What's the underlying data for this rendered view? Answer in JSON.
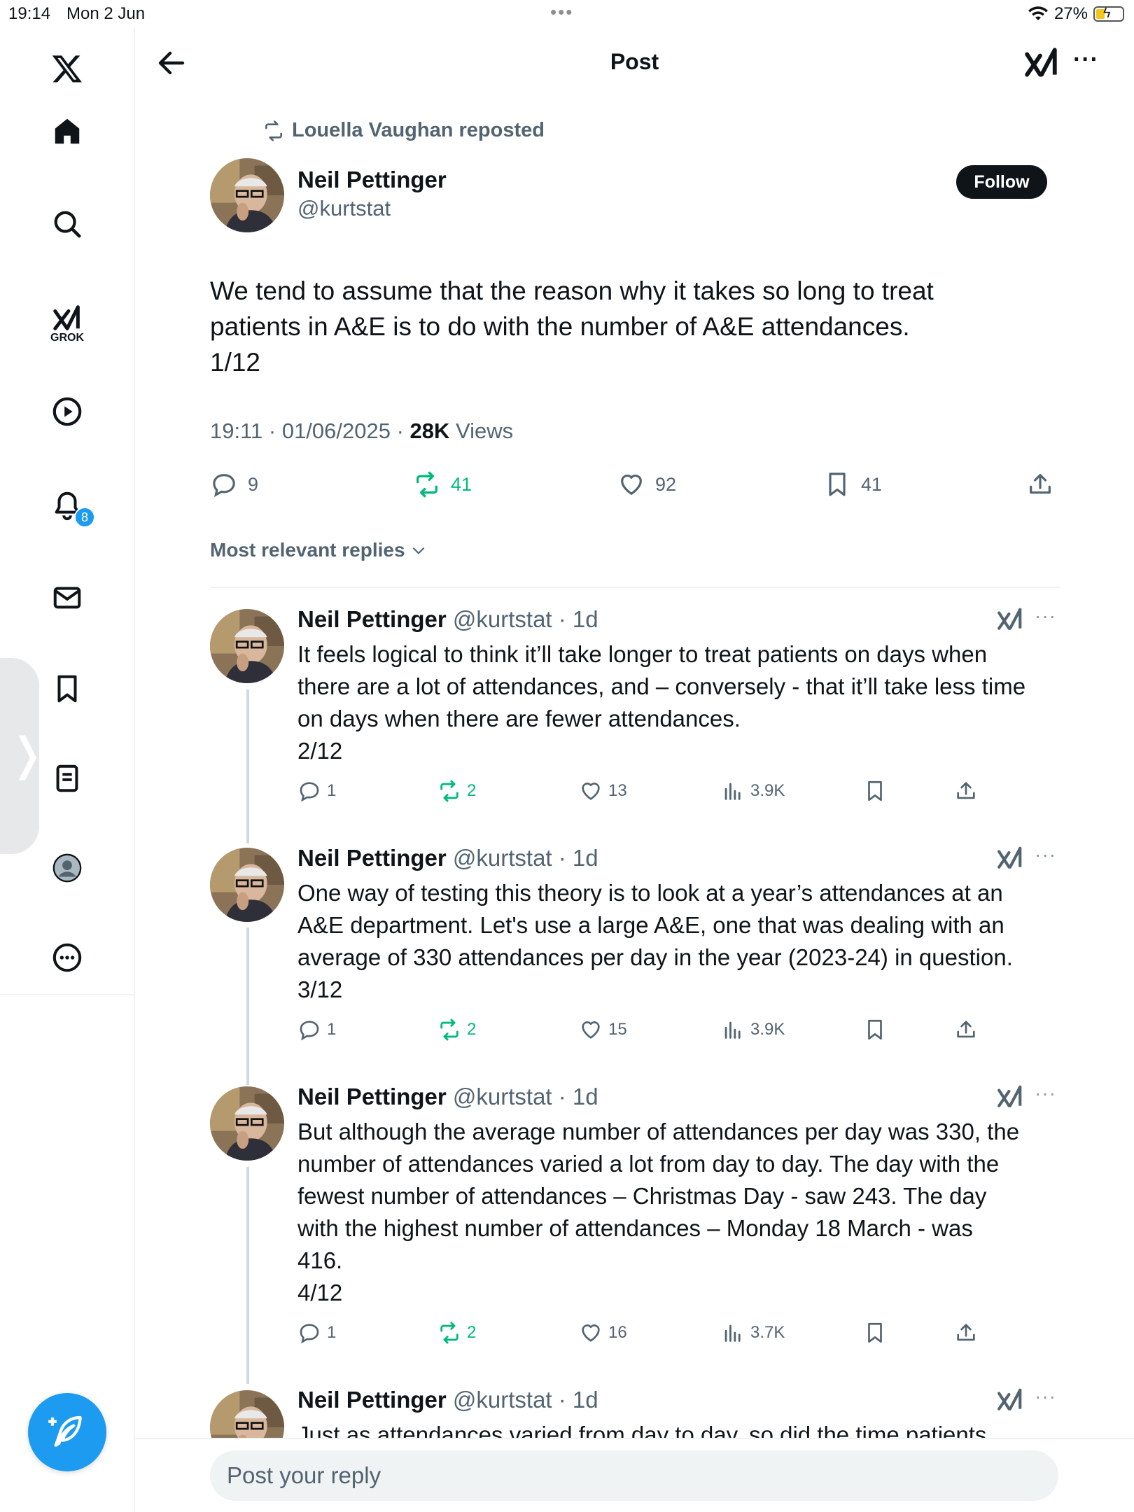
{
  "status_bar": {
    "time": "19:14",
    "date": "Mon 2 Jun",
    "battery": "27%"
  },
  "sidebar": {
    "grok_label": "GROK",
    "notifications_badge": "8"
  },
  "header": {
    "title": "Post"
  },
  "repost": {
    "text": "Louella Vaughan reposted"
  },
  "main_post": {
    "name": "Neil Pettinger",
    "handle": "@kurtstat",
    "follow_label": "Follow",
    "text": "We tend to assume that the reason why it takes so long to treat\npatients in A&E is to do with the number of A&E attendances.\n1/12",
    "timestamp": "19:11 · 01/06/2025 · ",
    "views_count": "28K",
    "views_label": " Views",
    "replies": "9",
    "reposts": "41",
    "likes": "92",
    "bookmarks": "41"
  },
  "sort_label": "Most relevant replies",
  "replies": [
    {
      "name": "Neil Pettinger",
      "handle": " @kurtstat · 1d",
      "text": "It feels logical to think it’ll take longer to treat patients on days when\nthere are a lot of attendances, and – conversely - that it’ll take less time\non days when there are fewer attendances.\n2/12",
      "replies": "1",
      "reposts": "2",
      "likes": "13",
      "views": "3.9K"
    },
    {
      "name": "Neil Pettinger",
      "handle": " @kurtstat · 1d",
      "text": "One way of testing this theory is to look at a year’s attendances at an\nA&E department. Let's use a large A&E, one that was dealing with an\naverage of 330 attendances per day in the year (2023-24) in question.\n3/12",
      "replies": "1",
      "reposts": "2",
      "likes": "15",
      "views": "3.9K"
    },
    {
      "name": "Neil Pettinger",
      "handle": " @kurtstat · 1d",
      "text": "But although the average number of attendances per day was 330, the\nnumber of attendances varied a lot from day to day. The day with the\nfewest number of attendances – Christmas Day - saw 243. The day\nwith the highest number of attendances – Monday 18 March - was\n416.\n4/12",
      "replies": "1",
      "reposts": "2",
      "likes": "16",
      "views": "3.7K"
    },
    {
      "name": "Neil Pettinger",
      "handle": " @kurtstat · 1d",
      "text": "Just as attendances varied from day to day, so did the time patients"
    }
  ],
  "reply_bar": {
    "placeholder": "Post your reply"
  }
}
